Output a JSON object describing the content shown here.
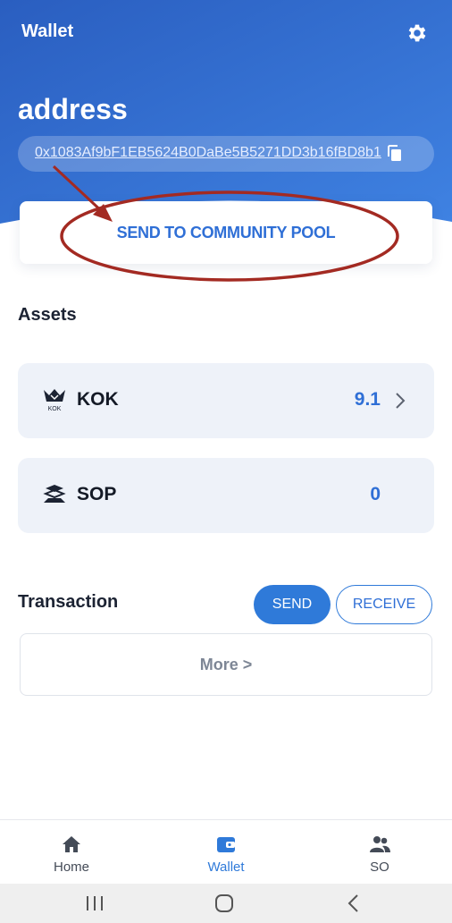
{
  "header": {
    "title": "Wallet",
    "settings_icon": "gear-icon",
    "gradient_start": "#2b63c4",
    "gradient_end": "#3c7ee0"
  },
  "address": {
    "heading": "address",
    "value": "0x1083Af9bF1EB5624B0DaBe5B5271DD3b16fBD8b1",
    "copy_icon": "copy-icon"
  },
  "community_pool": {
    "label": "SEND TO COMMUNITY POOL"
  },
  "annotation": {
    "color": "#a32a22"
  },
  "assets": {
    "title": "Assets",
    "items": [
      {
        "name": "KOK",
        "value": "9.1",
        "icon": "kok-logo-icon",
        "icon_text": "KOK",
        "has_chevron": true
      },
      {
        "name": "SOP",
        "value": "0",
        "icon": "sop-logo-icon",
        "has_chevron": false
      }
    ]
  },
  "transaction": {
    "title": "Transaction",
    "send_label": "SEND",
    "receive_label": "RECEIVE",
    "more_label": "More >"
  },
  "tabs": [
    {
      "label": "Home",
      "icon": "home-icon",
      "active": false
    },
    {
      "label": "Wallet",
      "icon": "wallet-icon",
      "active": true
    },
    {
      "label": "SO",
      "icon": "people-icon",
      "active": false
    }
  ],
  "accent_color": "#2f7ad9"
}
